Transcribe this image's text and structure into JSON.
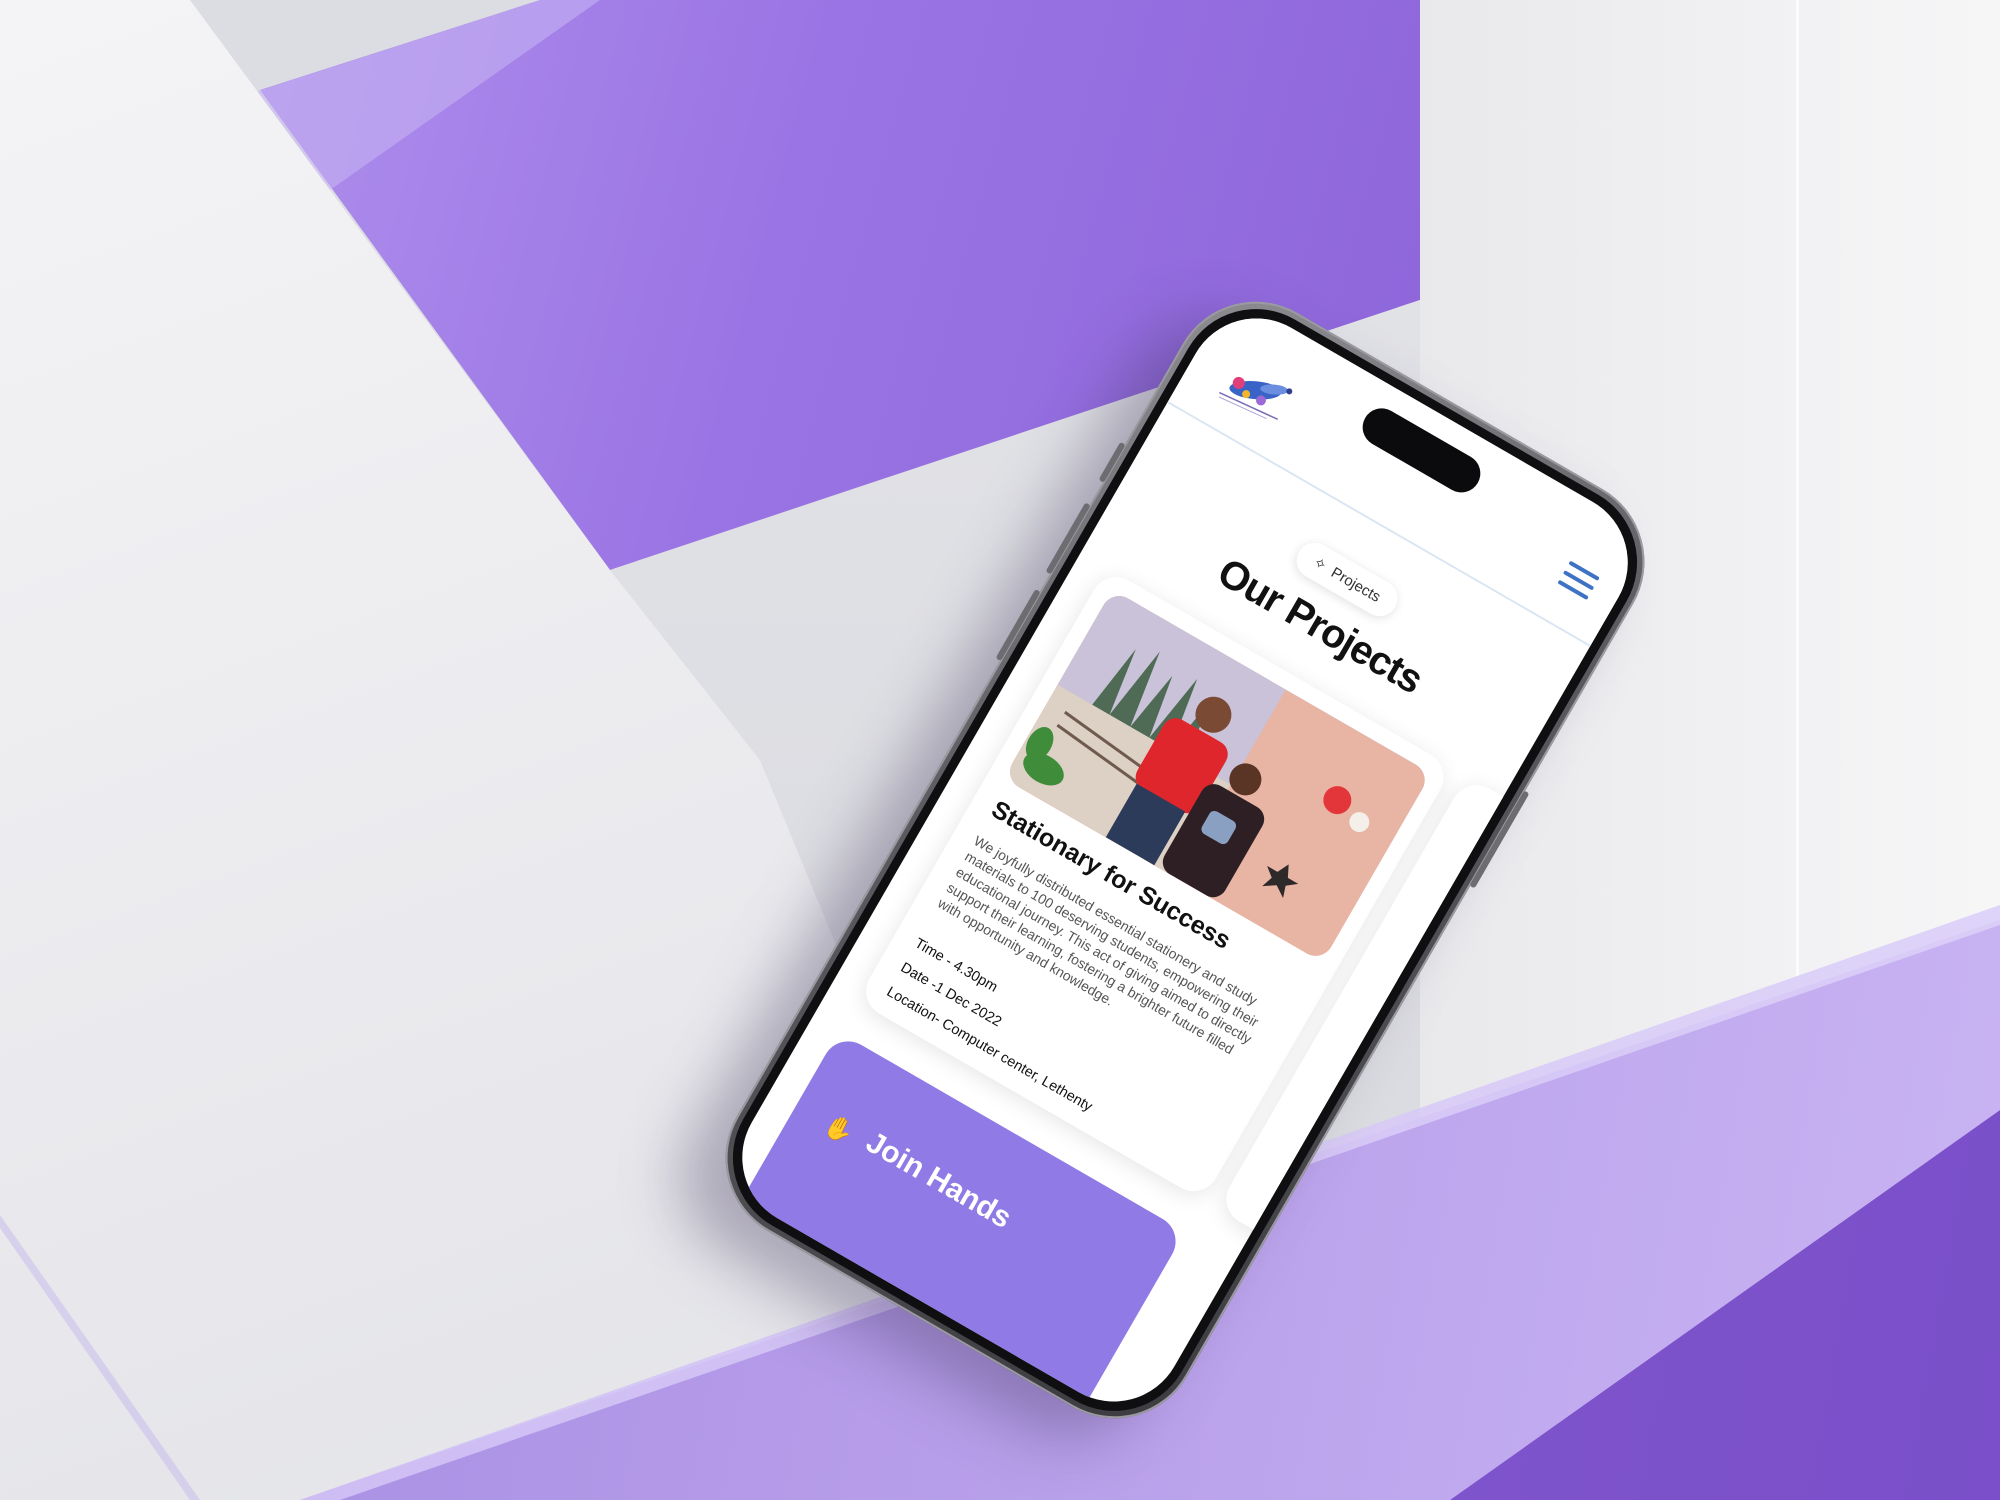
{
  "scene": {
    "accent_purple": "#8a62d4",
    "light_purple": "#b49ae8",
    "background_gray": "#dcdde2"
  },
  "app": {
    "header": {
      "logo": "brand-logo",
      "menu_icon": "hamburger-menu-icon",
      "menu_color": "#3e72c4"
    },
    "section": {
      "pill_icon": "sparkle-icon",
      "pill_label": "Projects",
      "title": "Our Projects"
    },
    "projects": [
      {
        "title": "Stationary for Success",
        "description": "We joyfully distributed essential stationery and study materials to 100 deserving students, empowering their educational journey. This act of giving aimed to directly support their learning, fostering a brighter future filled with opportunity and knowledge.",
        "time": "Time - 4.30pm",
        "date": "Date -1 Dec 2022",
        "location": "Location- Computer center, Lethenty"
      }
    ],
    "join": {
      "title": "Join Hands",
      "icon": "hand-heart-icon",
      "color": "#8f7ae6"
    }
  }
}
